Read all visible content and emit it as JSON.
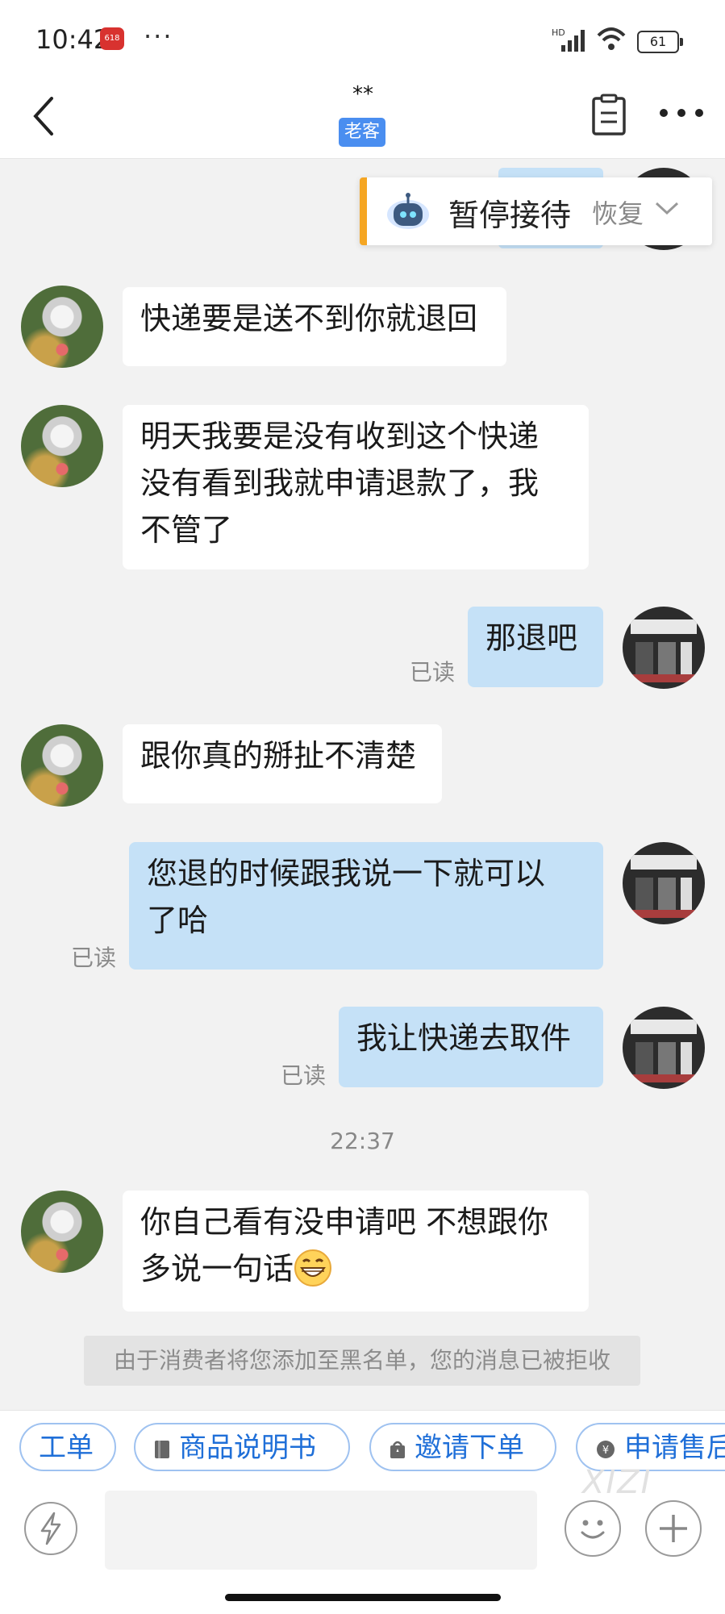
{
  "status_bar": {
    "time": "10:42",
    "badge": "618",
    "overflow": "···",
    "network": "HD",
    "battery": "61"
  },
  "header": {
    "contact_name": "**",
    "contact_tag": "老客"
  },
  "bot_status": {
    "state": "暂停接待",
    "action": "恢复"
  },
  "messages": [
    {
      "from": "customer",
      "text": "快递要是送不到你就退回"
    },
    {
      "from": "customer",
      "text": "明天我要是没有收到这个快递\n没有看到我就申请退款了，我\n不管了"
    },
    {
      "from": "seller",
      "text": "那退吧",
      "read": "已读"
    },
    {
      "from": "customer",
      "text": "跟你真的掰扯不清楚"
    },
    {
      "from": "seller",
      "text": "您退的时候跟我说一下就可以\n了哈",
      "read": "已读"
    },
    {
      "from": "seller",
      "text": "我让快递去取件",
      "read": "已读"
    },
    {
      "from": "customer",
      "text": "你自己看有没申请吧 不想跟你\n多说一句话",
      "emoji": "grin-emoji"
    }
  ],
  "time_separator": "22:37",
  "system_notice": "由于消费者将您添加至黑名单，您的消息已被拒收",
  "quick_actions": [
    {
      "label": "工单",
      "icon": ""
    },
    {
      "label": "商品说明书",
      "icon": "book-icon"
    },
    {
      "label": "邀请下单",
      "icon": "bag-icon"
    },
    {
      "label": "申请售后",
      "icon": "yen-icon"
    }
  ],
  "watermark": "XIZI",
  "colors": {
    "accent": "#1f6fd8",
    "outgoing_bubble": "#c5e1f7",
    "tag": "#4a8ef0",
    "bot_bar": "#f5a623"
  }
}
